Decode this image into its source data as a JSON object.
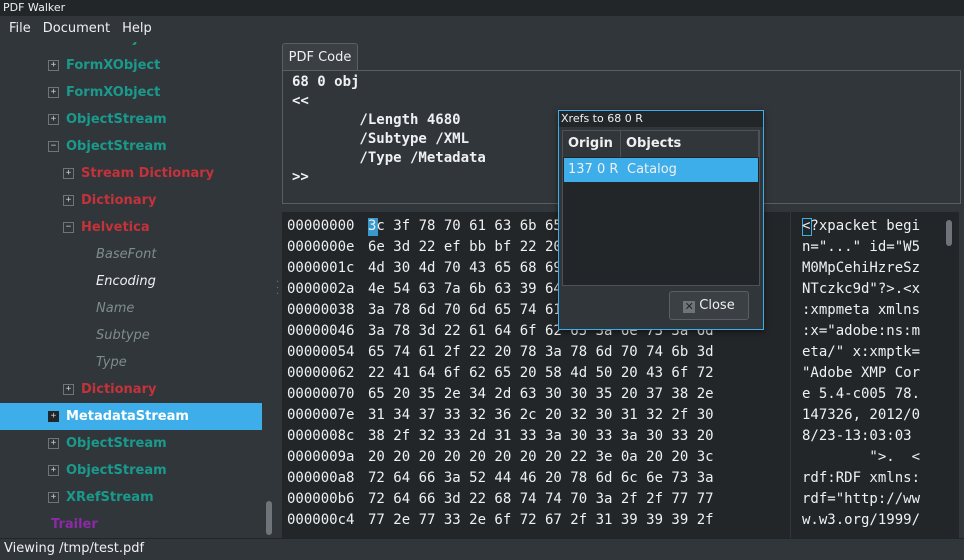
{
  "window": {
    "title": "PDF Walker"
  },
  "menu": [
    "File",
    "Document",
    "Help"
  ],
  "tree": [
    {
      "label": "FormXObject",
      "style": "c-teal",
      "level": 1,
      "expander": "+",
      "selected": false
    },
    {
      "label": "FormXObject",
      "style": "c-teal",
      "level": 1,
      "expander": "+",
      "selected": false
    },
    {
      "label": "ObjectStream",
      "style": "c-teal",
      "level": 1,
      "expander": "+",
      "selected": false
    },
    {
      "label": "ObjectStream",
      "style": "c-teal",
      "level": 1,
      "expander": "−",
      "selected": false
    },
    {
      "label": "Stream Dictionary",
      "style": "c-red",
      "level": 2,
      "expander": "+",
      "selected": false
    },
    {
      "label": "Dictionary",
      "style": "c-red",
      "level": 2,
      "expander": "+",
      "selected": false
    },
    {
      "label": "Helvetica",
      "style": "c-red",
      "level": 2,
      "expander": "−",
      "selected": false
    },
    {
      "label": "BaseFont",
      "style": "c-gray",
      "level": 3,
      "expander": "",
      "selected": false
    },
    {
      "label": "Encoding",
      "style": "c-light",
      "level": 3,
      "expander": "",
      "selected": false
    },
    {
      "label": "Name",
      "style": "c-gray",
      "level": 3,
      "expander": "",
      "selected": false
    },
    {
      "label": "Subtype",
      "style": "c-gray",
      "level": 3,
      "expander": "",
      "selected": false
    },
    {
      "label": "Type",
      "style": "c-gray",
      "level": 3,
      "expander": "",
      "selected": false
    },
    {
      "label": "Dictionary",
      "style": "c-red",
      "level": 2,
      "expander": "+",
      "selected": false
    },
    {
      "label": "MetadataStream",
      "style": "c-white",
      "level": 1,
      "expander": "+",
      "selected": true
    },
    {
      "label": "ObjectStream",
      "style": "c-teal",
      "level": 1,
      "expander": "+",
      "selected": false
    },
    {
      "label": "ObjectStream",
      "style": "c-teal",
      "level": 1,
      "expander": "+",
      "selected": false
    },
    {
      "label": "XRefStream",
      "style": "c-teal",
      "level": 1,
      "expander": "+",
      "selected": false
    },
    {
      "label": "Trailer",
      "style": "c-purple",
      "level": 0,
      "expander": "",
      "selected": false
    }
  ],
  "code": {
    "tab_label": "PDF Code",
    "text": "68 0 obj\n<<\n        /Length 4680\n        /Subtype /XML\n        /Type /Metadata\n>>"
  },
  "hex": {
    "offsets": [
      "00000000",
      "0000000e",
      "0000001c",
      "0000002a",
      "00000038",
      "00000046",
      "00000054",
      "00000062",
      "00000070",
      "0000007e",
      "0000008c",
      "0000009a",
      "000000a8",
      "000000b6",
      "000000c4"
    ],
    "bytes": [
      "3c 3f 78 70 61 63 6b 65 74 20 62 65 67 69",
      "6e 3d 22 ef bb bf 22 20 69 64 3d 22 57 35",
      "4d 30 4d 70 43 65 68 69 48 7a 72 65 53 7a",
      "4e 54 63 7a 6b 63 39 64 22 3f 3e 0a 3c 78",
      "3a 78 6d 70 6d 65 74 61 20 78 6d 6c 6e 73",
      "3a 78 3d 22 61 64 6f 62 65 3a 6e 73 3a 6d",
      "65 74 61 2f 22 20 78 3a 78 6d 70 74 6b 3d",
      "22 41 64 6f 62 65 20 58 4d 50 20 43 6f 72",
      "65 20 35 2e 34 2d 63 30 30 35 20 37 38 2e",
      "31 34 37 33 32 36 2c 20 32 30 31 32 2f 30",
      "38 2f 32 33 2d 31 33 3a 30 33 3a 30 33 20",
      "20 20 20 20 20 20 20 20 22 3e 0a 20 20 3c",
      "72 64 66 3a 52 44 46 20 78 6d 6c 6e 73 3a",
      "72 64 66 3d 22 68 74 74 70 3a 2f 2f 77 77",
      "77 2e 77 33 2e 6f 72 67 2f 31 39 39 39 2f"
    ],
    "ascii": [
      "<?xpacket begi",
      "n=\"...\" id=\"W5",
      "M0MpCehiHzreSz",
      "NTczkc9d\"?>.<x",
      ":xmpmeta xmlns",
      ":x=\"adobe:ns:m",
      "eta/\" x:xmptk=",
      "\"Adobe XMP Cor",
      "e 5.4-c005 78.",
      "147326, 2012/0",
      "8/23-13:03:03 ",
      "        \">.  <",
      "rdf:RDF xmlns:",
      "rdf=\"http://ww",
      "w.w3.org/1999/"
    ]
  },
  "dialog": {
    "title": "Xrefs to 68 0 R",
    "columns": [
      "Origin",
      "Objects"
    ],
    "rows": [
      {
        "origin": "137 0 R",
        "objects": "Catalog"
      }
    ],
    "close_label": "Close"
  },
  "status": "Viewing /tmp/test.pdf"
}
